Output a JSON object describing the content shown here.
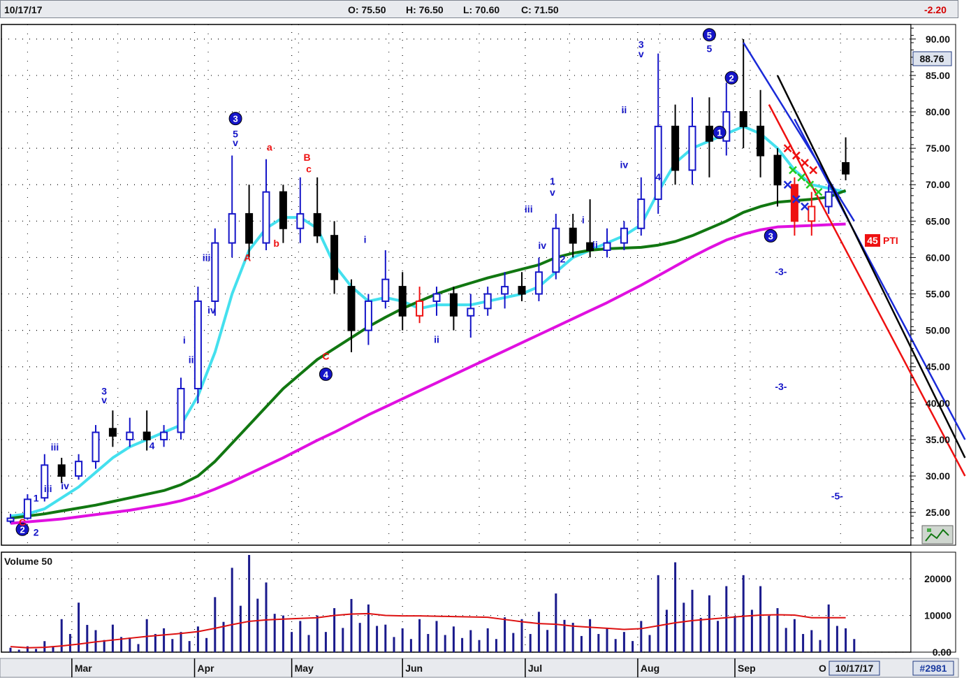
{
  "header": {
    "date": "10/17/17",
    "open": "O: 75.50",
    "high": "H: 76.50",
    "low": "L: 70.60",
    "close": "C: 71.50",
    "change": "-2.20"
  },
  "price_badge": "88.76",
  "pti_label": {
    "value": "45",
    "text": "PTI"
  },
  "volume_label": "Volume 50",
  "footer": {
    "date_box": "10/17/17",
    "id": "#2981",
    "last_month_fragment": "O"
  },
  "colors": {
    "up_candle": "#1515c8",
    "down_candle": "#000000",
    "red_candle": "#ee1111",
    "ma_cyan": "#44e0ee",
    "ma_green": "#117711",
    "ma_magenta": "#e010e0",
    "volume_bar": "#1a1a8c",
    "volume_ma": "#dd1111"
  },
  "icons": {
    "corner": "flag-chart-icon"
  },
  "chart_data": [
    {
      "type": "candlestick",
      "y_axis_ticks": [
        "90.00",
        "85.00",
        "80.00",
        "75.00",
        "70.00",
        "65.00",
        "60.00",
        "55.00",
        "50.00",
        "45.00",
        "40.00",
        "35.00",
        "30.00",
        "25.00"
      ],
      "ylim": [
        20.5,
        92
      ],
      "x_months": [
        "Mar",
        "Apr",
        "May",
        "Jun",
        "Jul",
        "Aug",
        "Sep"
      ],
      "weekly_candles": [
        [
          23.8,
          24.8,
          23.5,
          24.2
        ],
        [
          24.2,
          27.5,
          24,
          26.8
        ],
        [
          27,
          33,
          26.5,
          31.5
        ],
        [
          31.5,
          32.5,
          29,
          30
        ],
        [
          30,
          33,
          29.5,
          32
        ],
        [
          32,
          37,
          31,
          36
        ],
        [
          36.5,
          39,
          34,
          35.5
        ],
        [
          35,
          38,
          34,
          36
        ],
        [
          36,
          39,
          33.5,
          35
        ],
        [
          35,
          37,
          34,
          36
        ],
        [
          36,
          43.5,
          35,
          42
        ],
        [
          42,
          56,
          40,
          54
        ],
        [
          54,
          64,
          52,
          62
        ],
        [
          62,
          74,
          60,
          66
        ],
        [
          66,
          70,
          60,
          62
        ],
        [
          62,
          73.5,
          61,
          69
        ],
        [
          69,
          70,
          62,
          64
        ],
        [
          64,
          71,
          62,
          66
        ],
        [
          66,
          71,
          62,
          63
        ],
        [
          63,
          65,
          55,
          57
        ],
        [
          56,
          57,
          47,
          50
        ],
        [
          50,
          55,
          48,
          54
        ],
        [
          54,
          61,
          53,
          57
        ],
        [
          56,
          58,
          50,
          52
        ],
        [
          52,
          56,
          51,
          54
        ],
        [
          54,
          56,
          52,
          55
        ],
        [
          55,
          56,
          50,
          52
        ],
        [
          52,
          55,
          49,
          53
        ],
        [
          53,
          56,
          52,
          55
        ],
        [
          55,
          58,
          53,
          56
        ],
        [
          56,
          58,
          54,
          55
        ],
        [
          55,
          60,
          54,
          58
        ],
        [
          58,
          66,
          57,
          64
        ],
        [
          64,
          66,
          60,
          62
        ],
        [
          62,
          68,
          60,
          61
        ],
        [
          61,
          64,
          60,
          62
        ],
        [
          62,
          65,
          61,
          64
        ],
        [
          64,
          71,
          63,
          68
        ],
        [
          68,
          88,
          66,
          78
        ],
        [
          78,
          81,
          70,
          72
        ],
        [
          72,
          82,
          70,
          78
        ],
        [
          78,
          82,
          71,
          76
        ],
        [
          76,
          84,
          74,
          80
        ],
        [
          80,
          90,
          75,
          78
        ],
        [
          78,
          83,
          71,
          74
        ],
        [
          74,
          75,
          67,
          70
        ],
        [
          70,
          71,
          63,
          65
        ],
        [
          65,
          69,
          63,
          67
        ],
        [
          67,
          70,
          66,
          69
        ],
        [
          73,
          76.5,
          70.6,
          71.5
        ]
      ],
      "moving_averages": [
        {
          "name": "short",
          "color": "cyan",
          "values": [
            24.5,
            24.8,
            25.5,
            27,
            28.5,
            30.5,
            32.5,
            34,
            35,
            36,
            37,
            41,
            47,
            55,
            61,
            64,
            65.5,
            65.5,
            64,
            59,
            56,
            54,
            54.5,
            54,
            53,
            53.5,
            53.5,
            53.5,
            54,
            54.5,
            55,
            56,
            58,
            60,
            61,
            62,
            63,
            64.5,
            69,
            73,
            75,
            76,
            77,
            78,
            77,
            75,
            72,
            70,
            69.5,
            69
          ]
        },
        {
          "name": "medium",
          "color": "green",
          "values": [
            24.2,
            24.5,
            24.8,
            25.2,
            25.6,
            26,
            26.5,
            27,
            27.5,
            28,
            28.8,
            30,
            32,
            34.5,
            37,
            39.5,
            42,
            44,
            46,
            47.5,
            49,
            50.5,
            51.8,
            53,
            54,
            55,
            55.8,
            56.5,
            57.2,
            57.8,
            58.4,
            59,
            60,
            60.6,
            61,
            61.2,
            61.3,
            61.4,
            61.7,
            62.2,
            63,
            64,
            65,
            66.2,
            67,
            67.6,
            67.8,
            68,
            68.3,
            69.2
          ]
        },
        {
          "name": "long",
          "color": "magenta",
          "values": [
            23.5,
            23.7,
            23.9,
            24.1,
            24.4,
            24.7,
            25,
            25.3,
            25.7,
            26.1,
            26.6,
            27.3,
            28.2,
            29.2,
            30.3,
            31.4,
            32.5,
            33.7,
            34.9,
            36,
            37.2,
            38.4,
            39.5,
            40.6,
            41.7,
            42.8,
            43.9,
            45,
            46.1,
            47.2,
            48.3,
            49.4,
            50.5,
            51.6,
            52.7,
            53.8,
            55,
            56.2,
            57.5,
            58.8,
            60.1,
            61.3,
            62.4,
            63.2,
            63.8,
            64.2,
            64.3,
            64.4,
            64.5,
            64.6
          ]
        }
      ],
      "projection_lines": [
        {
          "color": "blue",
          "from": [
            43,
            89.5
          ],
          "to": [
            49.5,
            65
          ]
        },
        {
          "color": "blue",
          "from": [
            46,
            79
          ],
          "to": [
            56,
            35
          ]
        },
        {
          "color": "black",
          "from": [
            45,
            85
          ],
          "to": [
            56,
            32.5
          ]
        },
        {
          "color": "red",
          "from": [
            44.5,
            81
          ],
          "to": [
            56,
            30
          ]
        }
      ],
      "wave_labels": [
        {
          "text": "2",
          "circled": true,
          "color": "blue",
          "x": 0.7,
          "y": 22.2
        },
        {
          "text": "C",
          "circled": false,
          "color": "red",
          "x": 0.7,
          "y": 23.2
        },
        {
          "text": "1",
          "circled": false,
          "color": "blue",
          "x": 1.5,
          "y": 26.5
        },
        {
          "text": "2",
          "circled": false,
          "color": "blue",
          "x": 1.5,
          "y": 21.8
        },
        {
          "text": "iii",
          "circled": false,
          "color": "blue",
          "x": 2.2,
          "y": 27.8
        },
        {
          "text": "iii",
          "circled": false,
          "color": "blue",
          "x": 2.6,
          "y": 33.5
        },
        {
          "text": "iv",
          "circled": false,
          "color": "blue",
          "x": 3.2,
          "y": 28.2
        },
        {
          "text": "3",
          "circled": false,
          "color": "blue",
          "x": 5.5,
          "y": 41.2
        },
        {
          "text": "v",
          "circled": false,
          "color": "blue",
          "x": 5.5,
          "y": 40
        },
        {
          "text": "4",
          "circled": false,
          "color": "blue",
          "x": 8.3,
          "y": 33.7
        },
        {
          "text": "i",
          "circled": false,
          "color": "blue",
          "x": 10.2,
          "y": 48.2
        },
        {
          "text": "ii",
          "circled": false,
          "color": "blue",
          "x": 10.6,
          "y": 45.5
        },
        {
          "text": "iii",
          "circled": false,
          "color": "blue",
          "x": 11.5,
          "y": 59.5
        },
        {
          "text": "iv",
          "circled": false,
          "color": "blue",
          "x": 11.8,
          "y": 52.3
        },
        {
          "text": "3",
          "circled": true,
          "color": "blue",
          "x": 13.2,
          "y": 78.6
        },
        {
          "text": "5",
          "circled": false,
          "color": "blue",
          "x": 13.2,
          "y": 76.5
        },
        {
          "text": "v",
          "circled": false,
          "color": "blue",
          "x": 13.2,
          "y": 75.3
        },
        {
          "text": "A",
          "circled": false,
          "color": "red",
          "x": 13.9,
          "y": 59.5
        },
        {
          "text": "a",
          "circled": false,
          "color": "red",
          "x": 15.2,
          "y": 74.7
        },
        {
          "text": "b",
          "circled": false,
          "color": "red",
          "x": 15.6,
          "y": 61.5
        },
        {
          "text": "B",
          "circled": false,
          "color": "red",
          "x": 17.4,
          "y": 73.3
        },
        {
          "text": "c",
          "circled": false,
          "color": "red",
          "x": 17.5,
          "y": 71.7
        },
        {
          "text": "C",
          "circled": false,
          "color": "red",
          "x": 18.5,
          "y": 46
        },
        {
          "text": "4",
          "circled": true,
          "color": "blue",
          "x": 18.5,
          "y": 43.5
        },
        {
          "text": "i",
          "circled": false,
          "color": "blue",
          "x": 20.8,
          "y": 62
        },
        {
          "text": "ii",
          "circled": false,
          "color": "blue",
          "x": 25,
          "y": 48.3
        },
        {
          "text": "1",
          "circled": false,
          "color": "blue",
          "x": 31.8,
          "y": 70
        },
        {
          "text": "v",
          "circled": false,
          "color": "blue",
          "x": 31.8,
          "y": 68.5
        },
        {
          "text": "iii",
          "circled": false,
          "color": "blue",
          "x": 30.4,
          "y": 66.2
        },
        {
          "text": "iv",
          "circled": false,
          "color": "blue",
          "x": 31.2,
          "y": 61.2
        },
        {
          "text": "2",
          "circled": false,
          "color": "blue",
          "x": 32.4,
          "y": 59.3
        },
        {
          "text": "i",
          "circled": false,
          "color": "blue",
          "x": 33.6,
          "y": 64.7
        },
        {
          "text": "ii",
          "circled": false,
          "color": "blue",
          "x": 34.3,
          "y": 61.3
        },
        {
          "text": "3",
          "circled": false,
          "color": "blue",
          "x": 37,
          "y": 88.8
        },
        {
          "text": "v",
          "circled": false,
          "color": "blue",
          "x": 37,
          "y": 87.5
        },
        {
          "text": "ii",
          "circled": false,
          "color": "blue",
          "x": 36,
          "y": 79.8
        },
        {
          "text": "iv",
          "circled": false,
          "color": "blue",
          "x": 36,
          "y": 72.3
        },
        {
          "text": "4",
          "circled": false,
          "color": "blue",
          "x": 38,
          "y": 70.6
        },
        {
          "text": "5",
          "circled": true,
          "color": "blue",
          "x": 41,
          "y": 90.1
        },
        {
          "text": "5",
          "circled": false,
          "color": "blue",
          "x": 41,
          "y": 88.2
        },
        {
          "text": "2",
          "circled": true,
          "color": "blue",
          "x": 42.3,
          "y": 84.2
        },
        {
          "text": "1",
          "circled": true,
          "color": "blue",
          "x": 41.6,
          "y": 76.7
        },
        {
          "text": "3",
          "circled": true,
          "color": "blue",
          "x": 44.6,
          "y": 62.5
        },
        {
          "text": "-3-",
          "circled": false,
          "color": "blue",
          "x": 45.2,
          "y": 57.6
        },
        {
          "text": "-3-",
          "circled": false,
          "color": "blue",
          "x": 45.2,
          "y": 41.8
        },
        {
          "text": "-5-",
          "circled": false,
          "color": "blue",
          "x": 48.5,
          "y": 26.8
        }
      ]
    },
    {
      "type": "bar",
      "title": "Volume 50",
      "y_axis_ticks": [
        "20000",
        "10000",
        "0.00"
      ],
      "ylim": [
        0,
        26500
      ],
      "values": [
        1200,
        1600,
        3000,
        9000,
        13500,
        6000,
        7500,
        4000,
        9000,
        6500,
        5500,
        7000,
        15000,
        23000,
        26500,
        19000,
        10000,
        8500,
        10000,
        12000,
        14500,
        13000,
        7500,
        6500,
        9000,
        8500,
        7000,
        6000,
        6500,
        9500,
        9000,
        11000,
        16000,
        8000,
        9000,
        6500,
        5500,
        8500,
        21000,
        24500,
        17000,
        15500,
        18000,
        21000,
        18000,
        12000,
        9000,
        6000,
        13000,
        6500
      ],
      "moving_average": [
        1500,
        1200,
        1300,
        1700,
        2200,
        2800,
        3300,
        3800,
        4300,
        4700,
        5100,
        5600,
        6500,
        7500,
        8400,
        8800,
        9000,
        9200,
        9400,
        10000,
        10400,
        10500,
        10000,
        9900,
        9900,
        9800,
        9700,
        9600,
        9500,
        8900,
        8300,
        7800,
        7600,
        7100,
        6800,
        6500,
        6200,
        6400,
        7200,
        8000,
        8600,
        9000,
        9400,
        9800,
        10100,
        10200,
        10100,
        9400,
        9400,
        9400
      ]
    }
  ]
}
